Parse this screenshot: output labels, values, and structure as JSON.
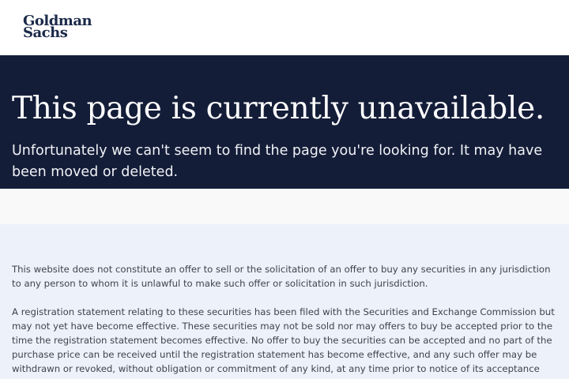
{
  "header": {
    "logo_line1": "Goldman",
    "logo_line2": "Sachs"
  },
  "hero": {
    "title": "This page is currently unavailable.",
    "subtitle": "Unfortunately we can't seem to find the page you're looking for. It may have been moved or deleted."
  },
  "disclaimer": {
    "paragraph1": "This website does not constitute an offer to sell or the solicitation of an offer to buy any securities in any jurisdiction to any person to whom it is unlawful to make such offer or solicitation in such jurisdiction.",
    "paragraph2": "A registration statement relating to these securities has been filed with the Securities and Exchange Commission but may not yet have become effective. These securities may not be sold nor may offers to buy be accepted prior to the time the registration statement becomes effective. No offer to buy the securities can be accepted and no part of the purchase price can be received until the registration statement has become effective, and any such offer may be withdrawn or revoked, without obligation or commitment of any kind, at any time prior to notice of its acceptance given after the"
  },
  "colors": {
    "brand_navy": "#141d38",
    "logo_navy": "#1b2a49",
    "disclaimer_bg": "#edf1f9"
  }
}
